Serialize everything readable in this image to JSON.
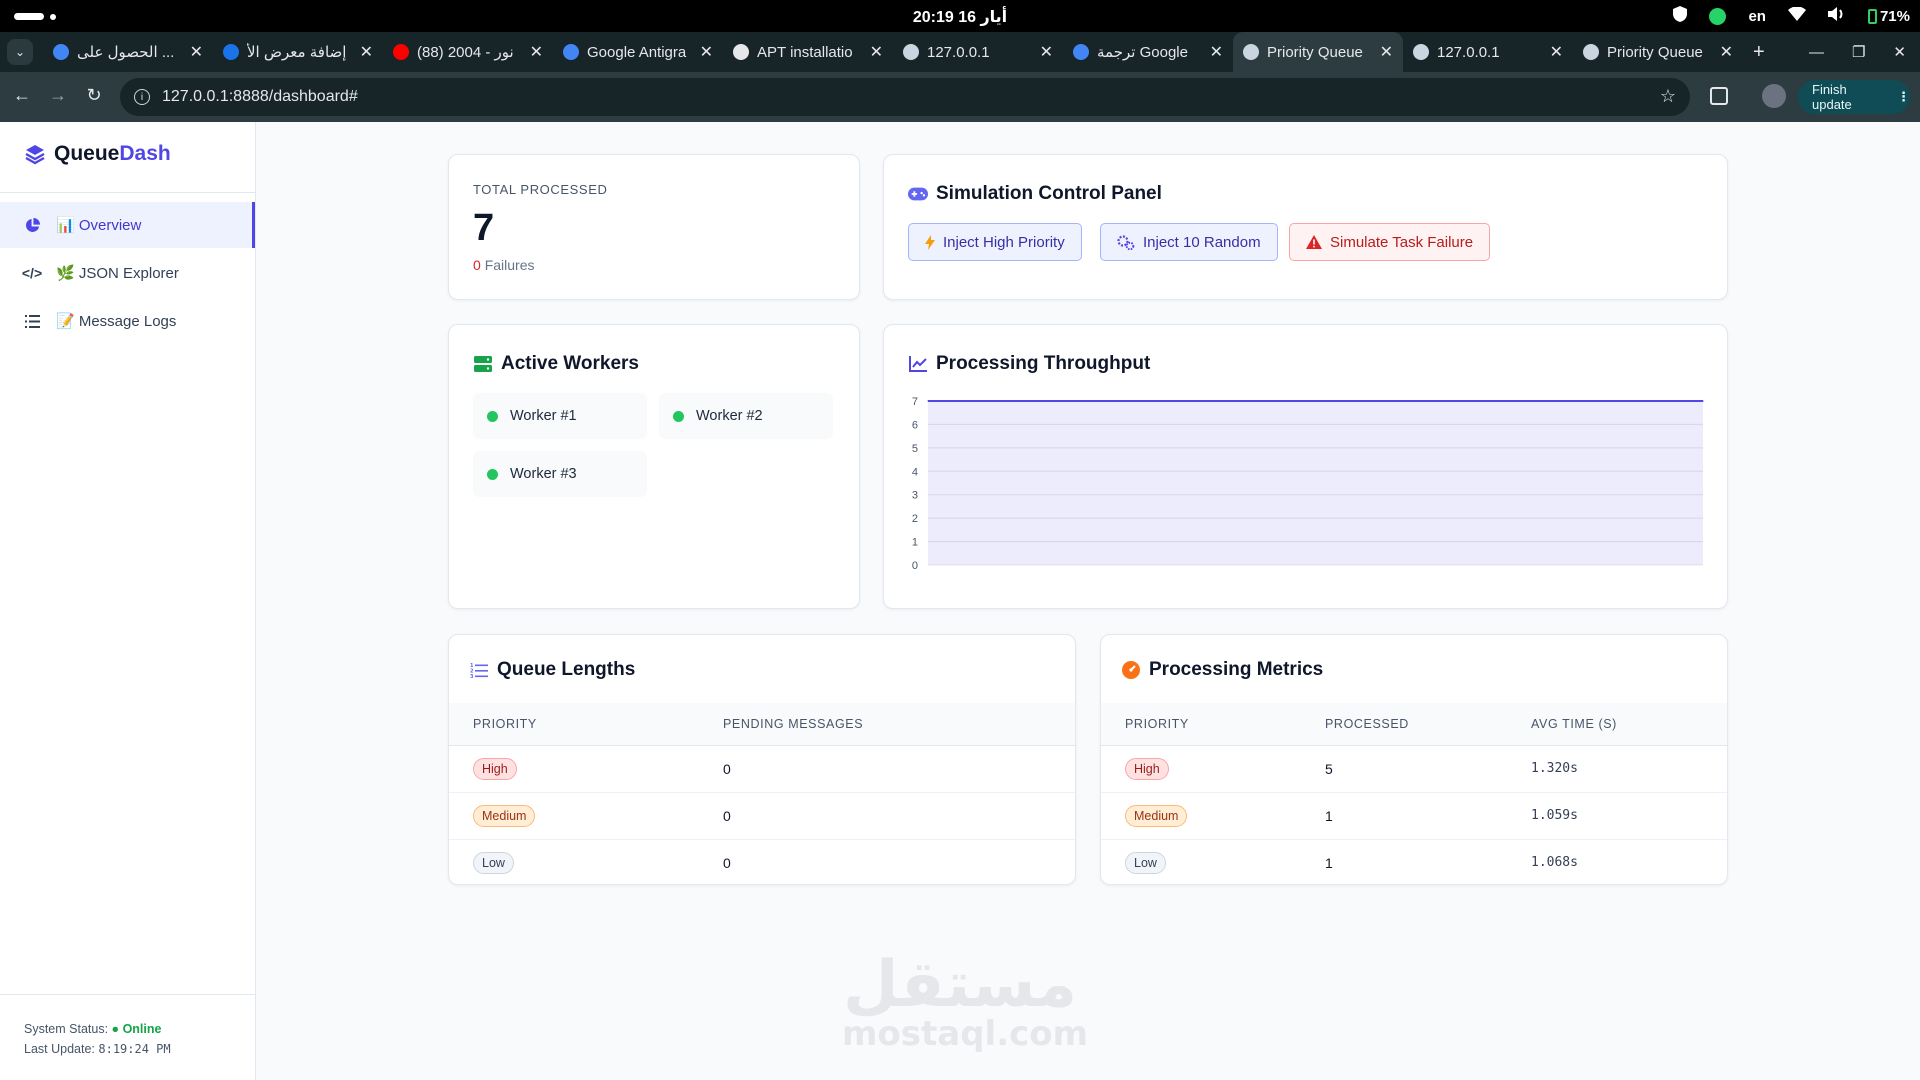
{
  "os": {
    "time": "20:19",
    "date": "16 أيار",
    "lang": "en",
    "battery": "71%"
  },
  "browser": {
    "tabs": [
      {
        "title": "الحصول على ...",
        "favicon_color": "#4285f4"
      },
      {
        "title": "إضافة معرض الأ",
        "favicon_color": "#1a73e8"
      },
      {
        "title": "(88) 2004 - نور",
        "favicon_color": "#ff0000"
      },
      {
        "title": "Google Antigra",
        "favicon_color": "#4285f4"
      },
      {
        "title": "APT installatio",
        "favicon_color": "#e5e7eb"
      },
      {
        "title": "127.0.0.1",
        "favicon_color": "#cbd5e1"
      },
      {
        "title": "ترجمة Google",
        "favicon_color": "#4285f4"
      },
      {
        "title": "Priority Queue",
        "favicon_color": "#cbd5e1",
        "active": true
      },
      {
        "title": "127.0.0.1",
        "favicon_color": "#cbd5e1"
      },
      {
        "title": "Priority Queue",
        "favicon_color": "#cbd5e1"
      }
    ],
    "new_tab": "+",
    "url": "127.0.0.1:8888/dashboard#",
    "finish_update": "Finish update"
  },
  "app": {
    "brand_prefix": "Queue",
    "brand_accent": "Dash",
    "accent_color": "#4f46e5",
    "nav": [
      {
        "label": "📊 Overview",
        "icon": "pie-chart-icon",
        "active": true
      },
      {
        "label": "🌿 JSON Explorer",
        "icon": "code-icon"
      },
      {
        "label": "📝 Message Logs",
        "icon": "list-icon"
      }
    ],
    "status_label": "System Status:",
    "status_value": "● Online",
    "last_update_label": "Last Update:",
    "last_update_value": "8:19:24 PM"
  },
  "stats": {
    "label": "TOTAL PROCESSED",
    "value": "7",
    "failures_count": "0",
    "failures_label": "Failures"
  },
  "simulation": {
    "title": "Simulation Control Panel",
    "buttons": [
      "Inject High Priority",
      "Inject 10 Random",
      "Simulate Task Failure"
    ]
  },
  "workers": {
    "title": "Active Workers",
    "items": [
      "Worker #1",
      "Worker #2",
      "Worker #3"
    ]
  },
  "throughput": {
    "title": "Processing Throughput"
  },
  "chart_data": {
    "type": "area",
    "title": "Processing Throughput",
    "xlabel": "",
    "ylabel": "",
    "ylim": [
      0,
      7
    ],
    "yticks": [
      0,
      1,
      2,
      3,
      4,
      5,
      6,
      7
    ],
    "grid": true,
    "series": [
      {
        "values": [
          7,
          7,
          7,
          7,
          7,
          7,
          7,
          7,
          7,
          7,
          7,
          7,
          7,
          7,
          7,
          7,
          7,
          7,
          7,
          7
        ],
        "color": "#4f46e5"
      }
    ]
  },
  "queue_lengths": {
    "title": "Queue Lengths",
    "headers": [
      "PRIORITY",
      "PENDING MESSAGES"
    ],
    "rows": [
      {
        "priority": "High",
        "pending": "0"
      },
      {
        "priority": "Medium",
        "pending": "0"
      },
      {
        "priority": "Low",
        "pending": "0"
      }
    ]
  },
  "metrics": {
    "title": "Processing Metrics",
    "headers": [
      "PRIORITY",
      "PROCESSED",
      "AVG TIME (S)"
    ],
    "rows": [
      {
        "priority": "High",
        "processed": "5",
        "avg": "1.320s"
      },
      {
        "priority": "Medium",
        "processed": "1",
        "avg": "1.059s"
      },
      {
        "priority": "Low",
        "processed": "1",
        "avg": "1.068s"
      }
    ]
  },
  "watermark": {
    "arabic": "مستقل",
    "latin": "mostaql.com"
  }
}
